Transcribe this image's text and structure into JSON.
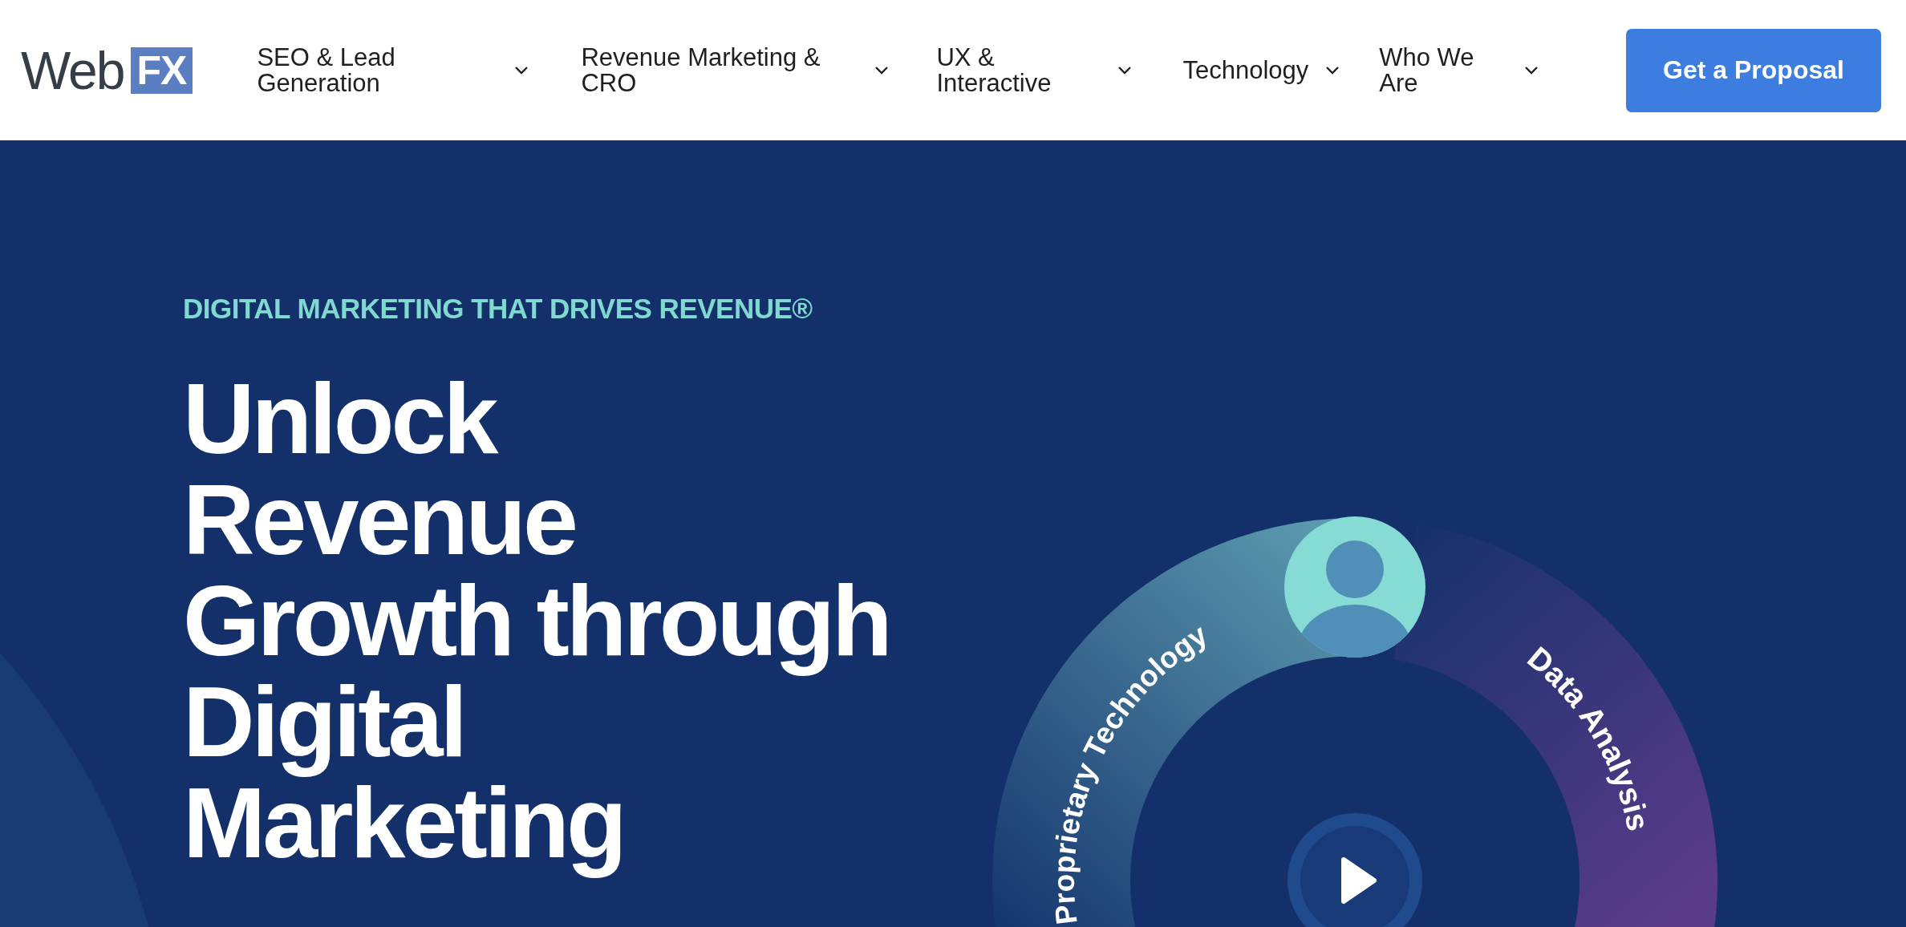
{
  "header": {
    "logo": {
      "word": "Web",
      "boxed": "FX"
    },
    "nav": [
      {
        "label": "SEO & Lead Generation",
        "expanded": false
      },
      {
        "label": "Revenue Marketing & CRO",
        "expanded": false
      },
      {
        "label": "UX & Interactive",
        "expanded": false
      },
      {
        "label": "Technology",
        "expanded": false
      },
      {
        "label": "Who We Are",
        "expanded": false
      }
    ],
    "cta": "Get a Proposal"
  },
  "hero": {
    "eyebrow": "DIGITAL MARKETING THAT DRIVES REVENUE®",
    "heading_lines": [
      "Unlock",
      "Revenue",
      "Growth through",
      "Digital",
      "Marketing"
    ],
    "graphic": {
      "arcs": [
        {
          "kind": "teal",
          "label": "Proprietary Technology"
        },
        {
          "kind": "purple",
          "label": "Data Analysis"
        }
      ]
    }
  }
}
